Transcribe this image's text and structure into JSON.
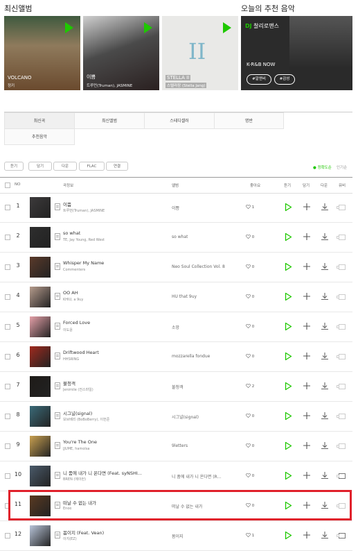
{
  "sections": {
    "new_albums": "최신앨범",
    "recommended": "오늘의 추천 음악"
  },
  "albums": [
    {
      "title": "VOLCANO",
      "artist": "정키",
      "bg": "#b08a5c"
    },
    {
      "title": "이쁨",
      "artist": "트루먼(Truman), JASMINE",
      "bg": "#3a3a3a"
    },
    {
      "title": "STELLA II",
      "artist": "스텔라장 (Stella Jang)",
      "bg": "#e8e8e6"
    }
  ],
  "recommendation": {
    "dj_prefix": "DJ",
    "dj": "찰리로맨스",
    "title": "K-R&B NOW",
    "tags": [
      "#알앤비",
      "#감성"
    ]
  },
  "tabs": [
    "최신곡",
    "최신앨범",
    "스테디셀러",
    "명반",
    "추천음악"
  ],
  "buttons": {
    "listen": "듣기",
    "add": "담기",
    "download": "다운",
    "flac": "FLAC",
    "ringtone": "연결"
  },
  "sort": {
    "accuracy": "● 정확도순",
    "popularity": "인기순"
  },
  "header": {
    "no": "NO",
    "song": "곡정보",
    "album": "앨범",
    "like": "좋아요",
    "listen": "듣기",
    "add": "담기",
    "download": "다운",
    "mv": "뮤비"
  },
  "songs": [
    {
      "no": "1",
      "title": "이쁨",
      "artist": "트루먼(Truman), JASMINE",
      "album": "이쁨",
      "likes": "1",
      "mv": false,
      "color": "#3c3a3b"
    },
    {
      "no": "2",
      "title": "so what",
      "artist": "TE, Jay Young, Red West",
      "album": "so what",
      "likes": "0",
      "mv": false,
      "color": "#2e2e2e"
    },
    {
      "no": "3",
      "title": "Whisper My Name",
      "artist": "Commenters",
      "album": "Neo Soul Collection Vol. 8",
      "likes": "0",
      "mv": false,
      "color": "#5a3a2a"
    },
    {
      "no": "4",
      "title": "OO AH",
      "artist": "KHIU, a 9uy",
      "album": "HU that 9uy",
      "likes": "0",
      "mv": false,
      "color": "#b59b8c"
    },
    {
      "no": "5",
      "title": "Forced Love",
      "artist": "이도윤",
      "album": "소망",
      "likes": "0",
      "mv": false,
      "color": "#e4a0a8"
    },
    {
      "no": "6",
      "title": "Driftwood Heart",
      "artist": "HHSRING",
      "album": "mozzarella fondue",
      "likes": "0",
      "mv": false,
      "color": "#a02a1e"
    },
    {
      "no": "7",
      "title": "불청객",
      "artist": "Jenimile (전스마일)",
      "album": "불청객",
      "likes": "2",
      "mv": false,
      "color": "#1e1b18"
    },
    {
      "no": "8",
      "title": "시그널(signal)",
      "artist": "보브베리 (BoBoBerry), 이헌준",
      "album": "시그널(signal)",
      "likes": "0",
      "mv": false,
      "color": "#3a6a78"
    },
    {
      "no": "9",
      "title": "You're The One",
      "artist": "JJUME, hamolsa",
      "album": "9letters",
      "likes": "0",
      "mv": false,
      "color": "#c8a050"
    },
    {
      "no": "10",
      "title": "니 품에 내가 니 온다면 (Feat. syNSHI...",
      "artist": "BREN (에이런)",
      "album": "니 품에 내가 니 온다면 (R...",
      "likes": "0",
      "mv": true,
      "color": "#4a5a6a"
    },
    {
      "no": "11",
      "title": "떠날 수 없는 내가",
      "artist": "Enoo",
      "album": "떠날 수 없는 내가",
      "likes": "0",
      "mv": false,
      "color": "#5a3a22"
    },
    {
      "no": "12",
      "title": "봄이지 (Feat. Vean)",
      "artist": "이지(EZ)",
      "album": "봄이지",
      "likes": "1",
      "mv": true,
      "color": "#b8c4d8"
    }
  ],
  "colors": {
    "accent": "#1ec800",
    "highlight": "#e0202b"
  }
}
